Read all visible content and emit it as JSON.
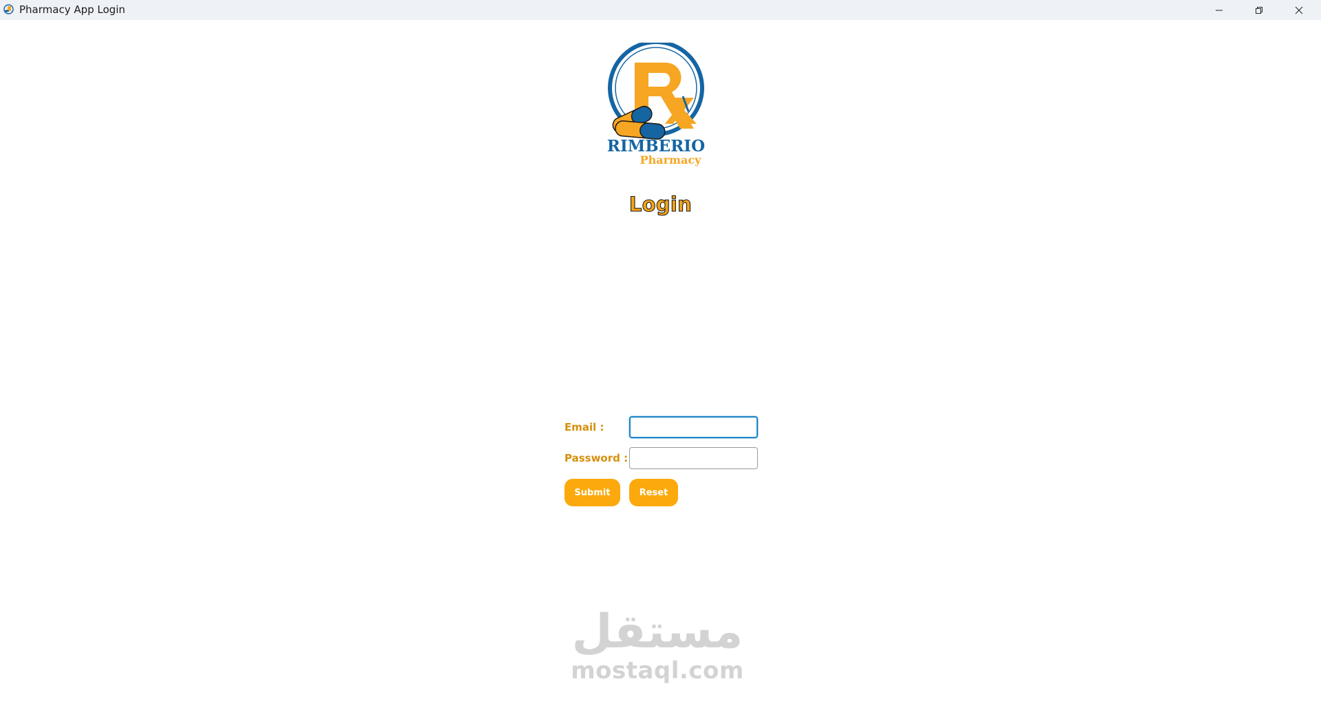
{
  "window": {
    "title": "Pharmacy App Login",
    "controls": [
      "minimize-icon",
      "restore-icon",
      "close-icon"
    ]
  },
  "logo": {
    "brand": "RIMBERIO",
    "subtitle": "Pharmacy",
    "symbol": "Rx",
    "colors": {
      "blue": "#1565a3",
      "orange": "#f6a623"
    }
  },
  "heading": {
    "title": "Login"
  },
  "form": {
    "email_label": "Email :",
    "email_value": "",
    "password_label": "Password :",
    "password_value": "",
    "submit_label": "Submit",
    "reset_label": "Reset"
  },
  "watermark": {
    "arabic": "مستقل",
    "latin": "mostaql.com"
  },
  "colors": {
    "accent": "#fba90d",
    "label": "#d68f0d",
    "focus": "#1c86c6"
  }
}
